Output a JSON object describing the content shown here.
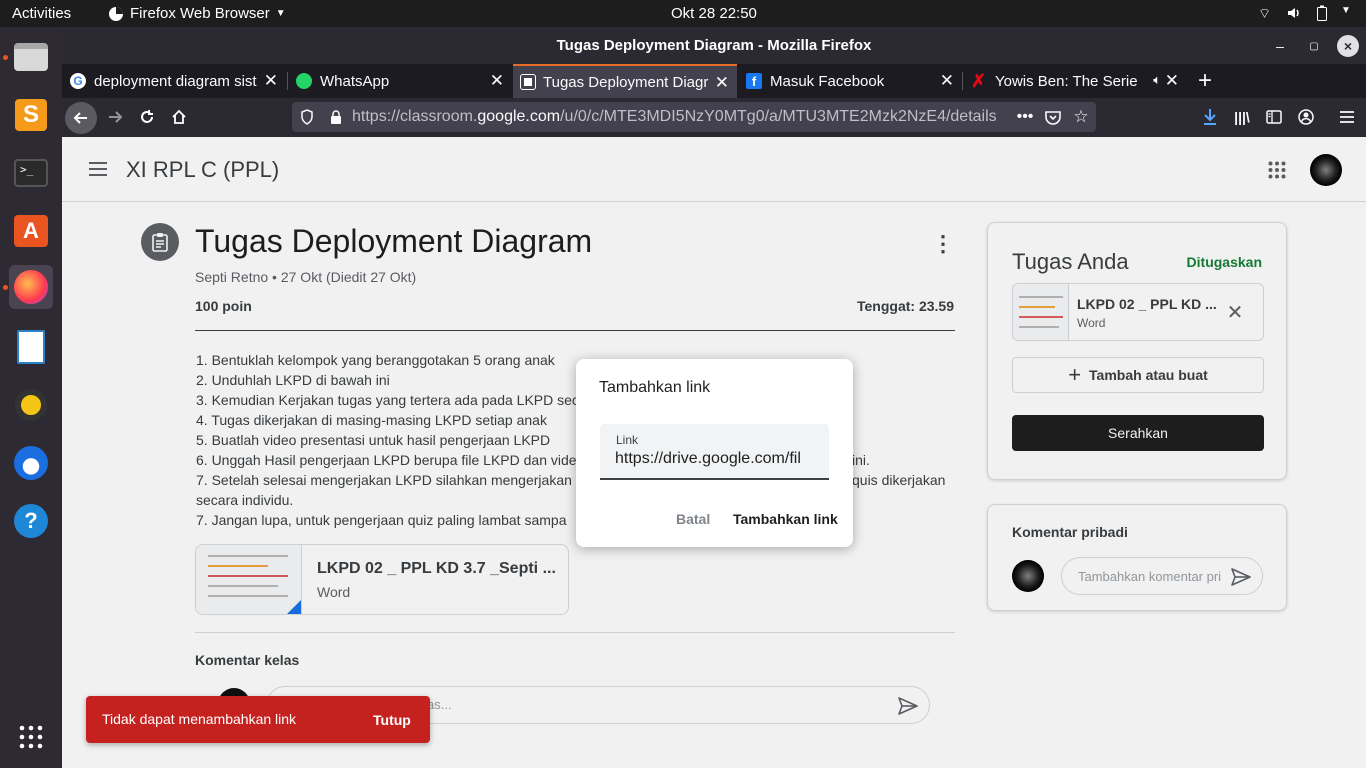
{
  "topbar": {
    "activities": "Activities",
    "app_menu": "Firefox Web Browser",
    "datetime": "Okt 28  22:50"
  },
  "window": {
    "title": "Tugas Deployment Diagram - Mozilla Firefox"
  },
  "tabs": [
    {
      "label": "deployment diagram sist"
    },
    {
      "label": "WhatsApp"
    },
    {
      "label": "Tugas Deployment Diagr"
    },
    {
      "label": "Masuk Facebook"
    },
    {
      "label": "Yowis Ben: The Series"
    }
  ],
  "url": {
    "prefix": "https://classroom.",
    "domain": "google.com",
    "path": "/u/0/c/MTE3MDI5NzY0MTg0/a/MTU3MTE2Mzk2NzE4/details"
  },
  "classroom": {
    "class_name": "XI RPL C (PPL)"
  },
  "assignment": {
    "title": "Tugas Deployment Diagram",
    "meta": "Septi Retno • 27 Okt (Diedit 27 Okt)",
    "points": "100 poin",
    "due": "Tenggat: 23.59",
    "instructions": [
      "1. Bentuklah kelompok yang beranggotakan 5 orang anak",
      "2. Unduhlah LKPD di bawah ini",
      "3. Kemudian Kerjakan tugas yang tertera ada pada LKPD sec",
      "4. Tugas dikerjakan di masing-masing LKPD setiap anak",
      "5. Buatlah video presentasi untuk hasil pengerjaan LKPD",
      "6. Unggah Hasil pengerjaan LKPD berupa file LKPD dan vide",
      "7. Setelah selesai mengerjakan LKPD silahkan mengerjakan",
      "secara individu.",
      "7. Jangan lupa, untuk pengerjaan quiz paling lambat sampa"
    ],
    "instruction_tail_6": "ini.",
    "instruction_tail_7": "quis dikerjakan",
    "attachment": {
      "name": "LKPD 02 _ PPL KD 3.7 _Septi ...",
      "type": "Word"
    },
    "class_comments_label": "Komentar kelas",
    "class_comment_placeholder": "as..."
  },
  "your_work": {
    "title": "Tugas Anda",
    "status": "Ditugaskan",
    "attachment": {
      "name": "LKPD 02 _ PPL KD ...",
      "type": "Word"
    },
    "add_button": "Tambah atau buat",
    "submit_button": "Serahkan"
  },
  "private_comments": {
    "title": "Komentar pribadi",
    "placeholder": "Tambahkan komentar pri"
  },
  "dialog": {
    "title": "Tambahkan link",
    "field_label": "Link",
    "field_value": "https://drive.google.com/fil",
    "cancel": "Batal",
    "confirm": "Tambahkan link"
  },
  "snackbar": {
    "message": "Tidak dapat menambahkan link",
    "action": "Tutup"
  },
  "colors": {
    "accent_green": "#188038",
    "snackbar_red": "#c5221f",
    "firefox_tab_accent": "#e66c25",
    "submit_bg": "#1f1f1f"
  }
}
